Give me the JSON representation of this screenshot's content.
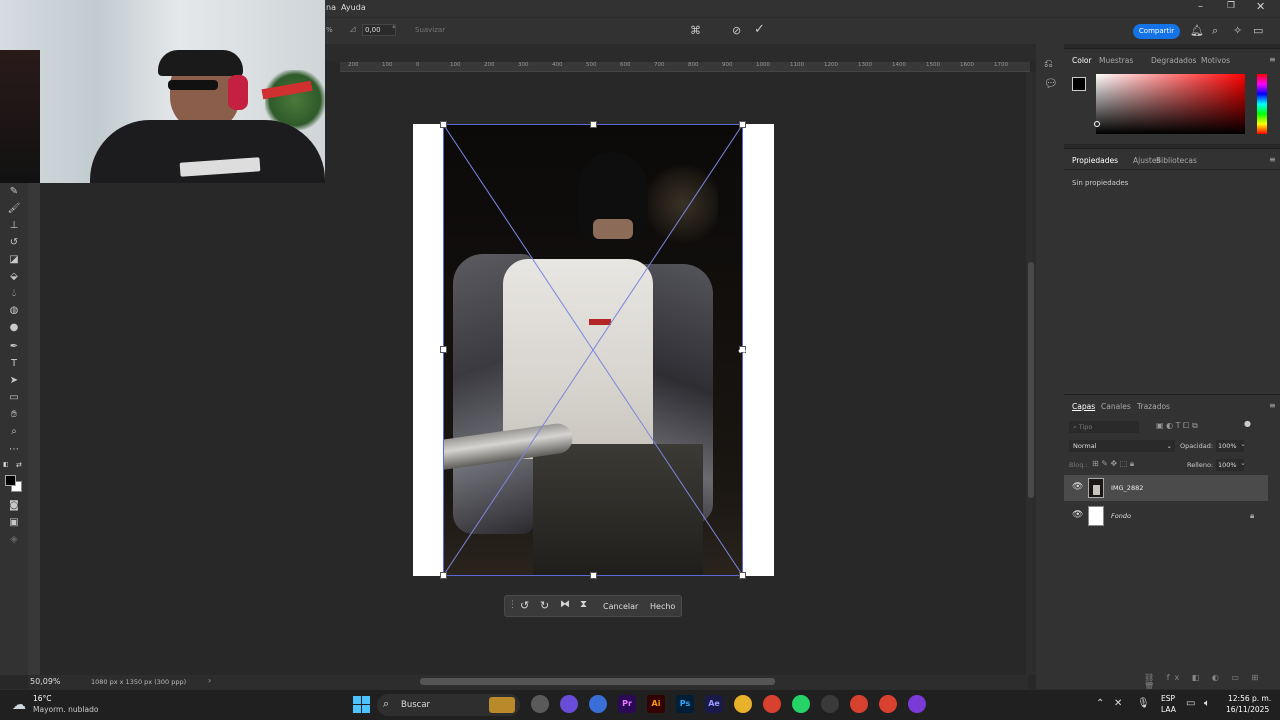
{
  "menubar": {
    "items": [
      "na",
      "Ayuda"
    ]
  },
  "options": {
    "angle_value": "0,00",
    "angle_unit": "°",
    "interp_label": "Suavizar",
    "zoom_partial": "%"
  },
  "header": {
    "share_label": "Compartir"
  },
  "ruler": {
    "ticks": [
      "200",
      "100",
      "0",
      "100",
      "200",
      "300",
      "400",
      "500",
      "600",
      "700",
      "800",
      "900",
      "1000",
      "1100",
      "1200",
      "1300",
      "1400",
      "1500",
      "1600",
      "1700"
    ]
  },
  "color_panel": {
    "tabs": [
      "Color",
      "Muestras",
      "Degradados",
      "Motivos"
    ]
  },
  "properties_panel": {
    "tabs": [
      "Propiedades",
      "Ajustes",
      "Bibliotecas"
    ],
    "empty_text": "Sin propiedades"
  },
  "layers_panel": {
    "tabs": [
      "Capas",
      "Canales",
      "Trazados"
    ],
    "search_placeholder": "Tipo",
    "blend_mode": "Normal",
    "opacity_label": "Opacidad:",
    "opacity_value": "100%",
    "lock_label": "Bloq.:",
    "fill_label": "Relleno:",
    "fill_value": "100%",
    "layers": [
      {
        "name": "IMG_2882",
        "selected": true
      },
      {
        "name": "Fondo",
        "locked": true
      }
    ]
  },
  "transform_bar": {
    "cancel_label": "Cancelar",
    "done_label": "Hecho"
  },
  "status": {
    "zoom": "50,09%",
    "doc_info": "1080 px x 1350 px (300 ppp)"
  },
  "taskbar": {
    "weather_temp": "16°C",
    "weather_desc": "Mayorm. nublado",
    "search_placeholder": "Buscar",
    "lang_line1": "ESP",
    "lang_line2": "LAA",
    "time": "12:56 p. m.",
    "date": "16/11/2025",
    "apps": [
      "files-app",
      "copilot-app",
      "store-app",
      "premiere-app",
      "illustrator-app",
      "photoshop-app",
      "aftereffects-app",
      "explorer-app",
      "chrome-app",
      "whatsapp-app",
      "chatgpt-app",
      "chrome-profile2-app",
      "chrome-profile3-app",
      "game-app"
    ]
  },
  "colors": {
    "accent": "#1473e6",
    "foreground_swatch": "#000000",
    "background_swatch": "#ffffff"
  }
}
